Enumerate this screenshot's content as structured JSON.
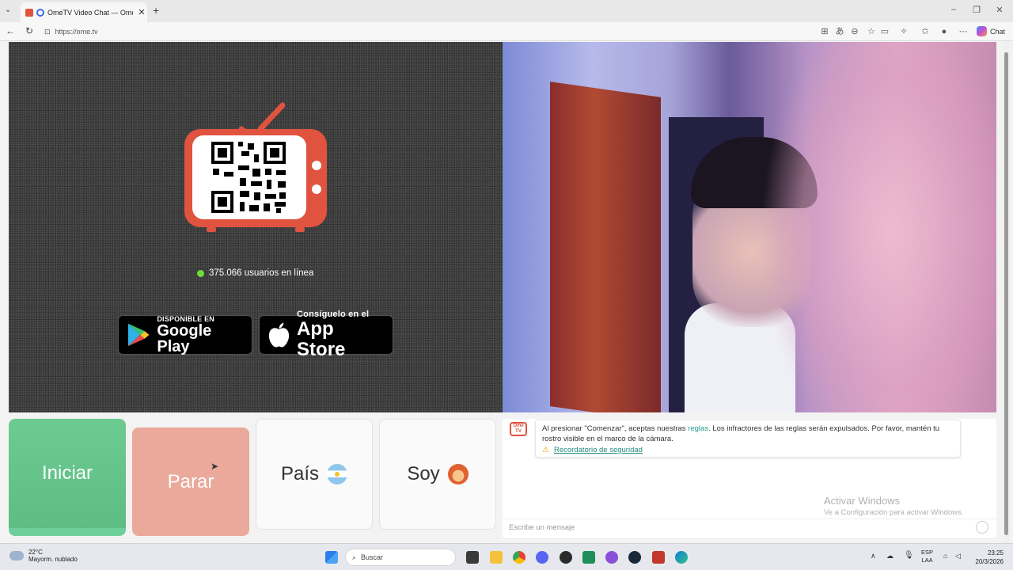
{
  "browser": {
    "tab_title": "OmeTV Video Chat — Omeg",
    "url": "https://ome.tv",
    "chat_label": "Chat"
  },
  "left_panel": {
    "online_count": "375.066 usuarios en línea",
    "google_play": {
      "small": "DISPONIBLE EN",
      "big": "Google Play"
    },
    "app_store": {
      "small": "Consíguelo en el",
      "big": "App Store"
    }
  },
  "buttons": {
    "start": "Iniciar",
    "stop": "Parar",
    "country": "País",
    "gender": "Soy"
  },
  "chat": {
    "logo_text": "Ome TV",
    "notice_pre": "Al presionar \"Comenzar\", aceptas nuestras ",
    "notice_link": "reglas",
    "notice_post": ". Los infractores de las reglas serán expulsados. Por favor, mantén tu rostro visible en el marco de la cámara.",
    "safety_link": "Recordatorio de seguridad",
    "watermark_title": "Activar Windows",
    "watermark_sub": "Ve a Configuración para activar Windows.",
    "input_placeholder": "Escribe un mensaje"
  },
  "taskbar": {
    "temp": "22°C",
    "weather": "Mayorm. nublado",
    "search": "Buscar",
    "lang1": "ESP",
    "lang2": "LAA",
    "time": "23:25",
    "date": "20/3/2026"
  },
  "colors": {
    "brand": "#e0533f",
    "start_green": "#6ccb91",
    "stop_salmon": "#eaa99a",
    "online_dot": "#6bdd39"
  }
}
